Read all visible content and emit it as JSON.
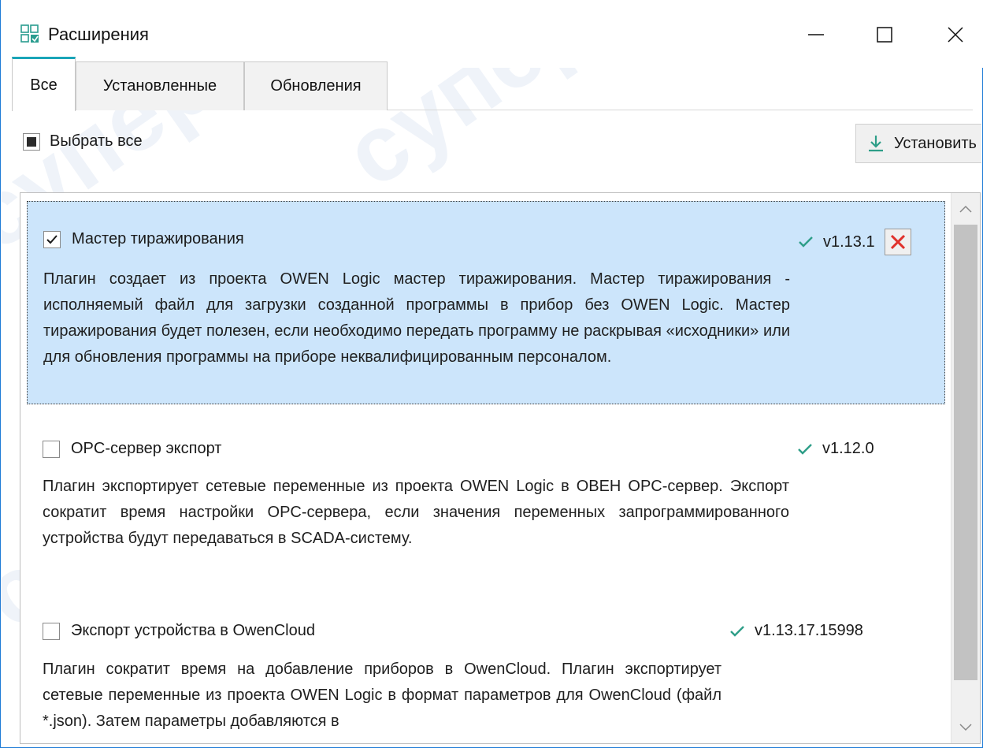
{
  "window": {
    "title": "Расширения",
    "icon": "extensions-icon",
    "controls": [
      "minimize-icon",
      "maximize-icon",
      "close-icon"
    ]
  },
  "tabs": [
    {
      "label": "Все",
      "active": true
    },
    {
      "label": "Установленные",
      "active": false
    },
    {
      "label": "Обновления",
      "active": false
    }
  ],
  "toolbar": {
    "select_all_label": "Выбрать все",
    "select_all_state": "partial",
    "install_label": "Установить",
    "install_icon": "download-icon"
  },
  "plugins": [
    {
      "name": "Мастер тиражирования",
      "checked": true,
      "selected": true,
      "version": "v1.13.1",
      "installed": true,
      "removable": true,
      "description": "Плагин создает из проекта OWEN Logic  мастер тиражирования. Мастер тиражирования - исполняемый файл для загрузки созданной программы в прибор без OWEN Logic. Мастер тиражирования будет полезен, если необходимо передать программу не раскрывая «исходники» или для обновления программы на приборе неквалифицированным персоналом."
    },
    {
      "name": "OPC-сервер экспорт",
      "checked": false,
      "selected": false,
      "version": "v1.12.0",
      "installed": true,
      "removable": false,
      "description": "Плагин экспортирует сетевые переменные из проекта OWEN Logic в ОВЕН OPC-сервер. Экспорт сократит время настройки OPC-сервера, если значения переменных запрограммированного устройства будут передаваться в SCADA-систему."
    },
    {
      "name": "Экспорт устройства в OwenCloud",
      "checked": false,
      "selected": false,
      "version": "v1.13.17.15998",
      "installed": true,
      "removable": false,
      "description": "Плагин сократит время на добавление приборов в OwenCloud. Плагин экспортирует сетевые переменные из проекта OWEN Logic в формат параметров для OwenCloud (файл *.json). Затем параметры добавляются в"
    }
  ],
  "colors": {
    "accent_tab": "#1aa5b8",
    "selection_bg": "#cce5fb",
    "check_green": "#2e9e88",
    "delete_red": "#e0312b",
    "window_border": "#1e7bd6"
  },
  "watermark": "супер"
}
